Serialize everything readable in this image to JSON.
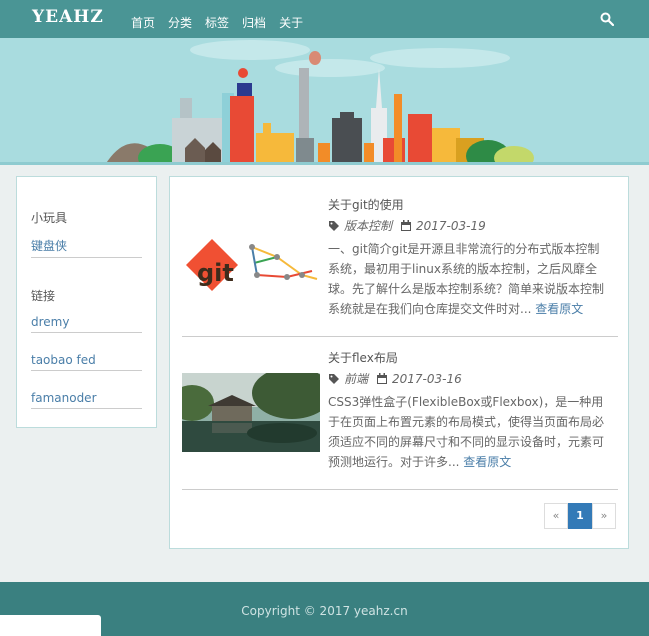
{
  "header": {
    "logo": "YEAHZ",
    "nav": [
      "首页",
      "分类",
      "标签",
      "归档",
      "关于"
    ]
  },
  "sidebar": {
    "toys_title": "小玩具",
    "toys": [
      "键盘侠"
    ],
    "links_title": "链接",
    "links": [
      "dremy",
      "taobao fed",
      "famanoder"
    ]
  },
  "posts": [
    {
      "title": "关于git的使用",
      "category": "版本控制",
      "date": "2017-03-19",
      "excerpt": "一、git简介git是开源且非常流行的分布式版本控制系统，最初用于linux系统的版本控制，之后风靡全球。先了解什么是版本控制系统？简单来说版本控制系统就是在我们向仓库提交文件时对...",
      "readmore": "查看原文",
      "thumb_text": "git"
    },
    {
      "title": "关于flex布局",
      "category": "前端",
      "date": "2017-03-16",
      "excerpt": "CSS3弹性盒子(FlexibleBox或Flexbox)，是一种用于在页面上布置元素的布局模式，使得当页面布局必须适应不同的屏幕尺寸和不同的显示设备时，元素可预测地运行。对于许多...",
      "readmore": "查看原文"
    }
  ],
  "pagination": {
    "prev": "«",
    "current": "1",
    "next": "»"
  },
  "footer": {
    "copyright": "Copyright © 2017 yeahz.cn"
  },
  "colors": {
    "header": "#4a9595",
    "banner": "#a9dcdf",
    "footer": "#3a8080",
    "link": "#4a7ea8",
    "accent": "#337ab7"
  }
}
